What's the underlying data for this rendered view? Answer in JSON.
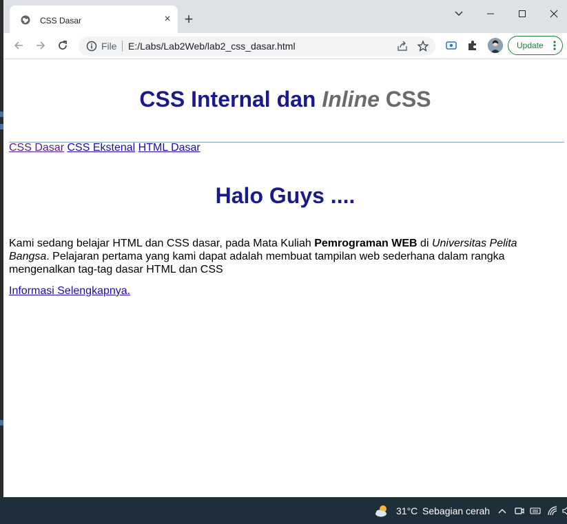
{
  "browser": {
    "tab": {
      "title": "CSS Dasar",
      "close_glyph": "×"
    },
    "newtab_glyph": "+",
    "window_controls": {
      "tabsearch": "⌄",
      "minimize": "—",
      "maximize": "☐",
      "close": "✕"
    },
    "omnibox": {
      "scheme_label": "File",
      "url": "E:/Labs/Lab2Web/lab2_css_dasar.html"
    },
    "update_button": {
      "label": "Update"
    },
    "colors": {
      "update_green": "#188038",
      "tabstrip": "#dee1e6"
    }
  },
  "page": {
    "title_main": "CSS Internal dan ",
    "title_italic": "Inline",
    "title_end": " CSS",
    "nav": [
      {
        "label": "CSS Dasar"
      },
      {
        "label": "CSS Ekstenal"
      },
      {
        "label": "HTML Dasar"
      }
    ],
    "heading": "Halo Guys ....",
    "paragraph": {
      "part1": "Kami sedang belajar HTML dan CSS dasar, pada Mata Kuliah ",
      "bold": "Pemrograman WEB",
      "part2": " di ",
      "italic": "Universitas Pelita Bangsa",
      "part3": ". Pelajaran pertama yang kami dapat adalah membuat tampilan web sederhana dalam rangka mengenalkan tag-tag dasar HTML dan CSS"
    },
    "more_link": "Informasi Selengkapnya.",
    "colors": {
      "heading": "#1a1a8c",
      "italic_gray": "#6b6b6b",
      "link": "#1a0dab",
      "visited": "#551a8b"
    }
  },
  "taskbar": {
    "weather_temp": "31°C",
    "weather_desc": "Sebagian cerah",
    "tray_icons": [
      "chevron-up-icon",
      "meet-now-icon",
      "keyboard-icon",
      "wifi-icon",
      "speaker-icon"
    ]
  }
}
